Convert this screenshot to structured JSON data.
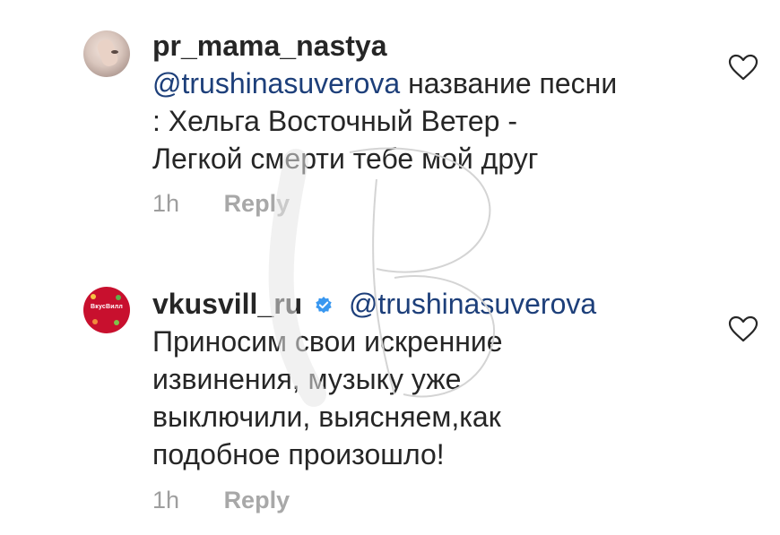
{
  "comments": [
    {
      "username": "pr_mama_nastya",
      "verified": false,
      "mention": "@trushinasuverova",
      "text_line1_rest": " название песни",
      "text_lines": [
        ": Хельга Восточный Ветер -",
        "Легкой смерти тебе мой друг"
      ],
      "time": "1h",
      "reply_label": "Reply",
      "avatar_icon": "user-photo-avatar",
      "like_icon": "heart-outline-icon"
    },
    {
      "username": "vkusvill_ru",
      "verified": true,
      "mention": "@trushinasuverova",
      "text_lines": [
        "Приносим свои искренние",
        "извинения, музыку уже",
        "выключили, выясняем,как",
        "подобное произошло!"
      ],
      "time": "1h",
      "reply_label": "Reply",
      "avatar_brand_text": "ВкусВилл",
      "avatar_icon": "brand-logo-avatar",
      "like_icon": "heart-outline-icon"
    }
  ],
  "colors": {
    "text": "#262626",
    "mention": "#1d3f7a",
    "meta": "#9e9e9e",
    "verified": "#3897f0",
    "brand_red": "#c8102e"
  }
}
